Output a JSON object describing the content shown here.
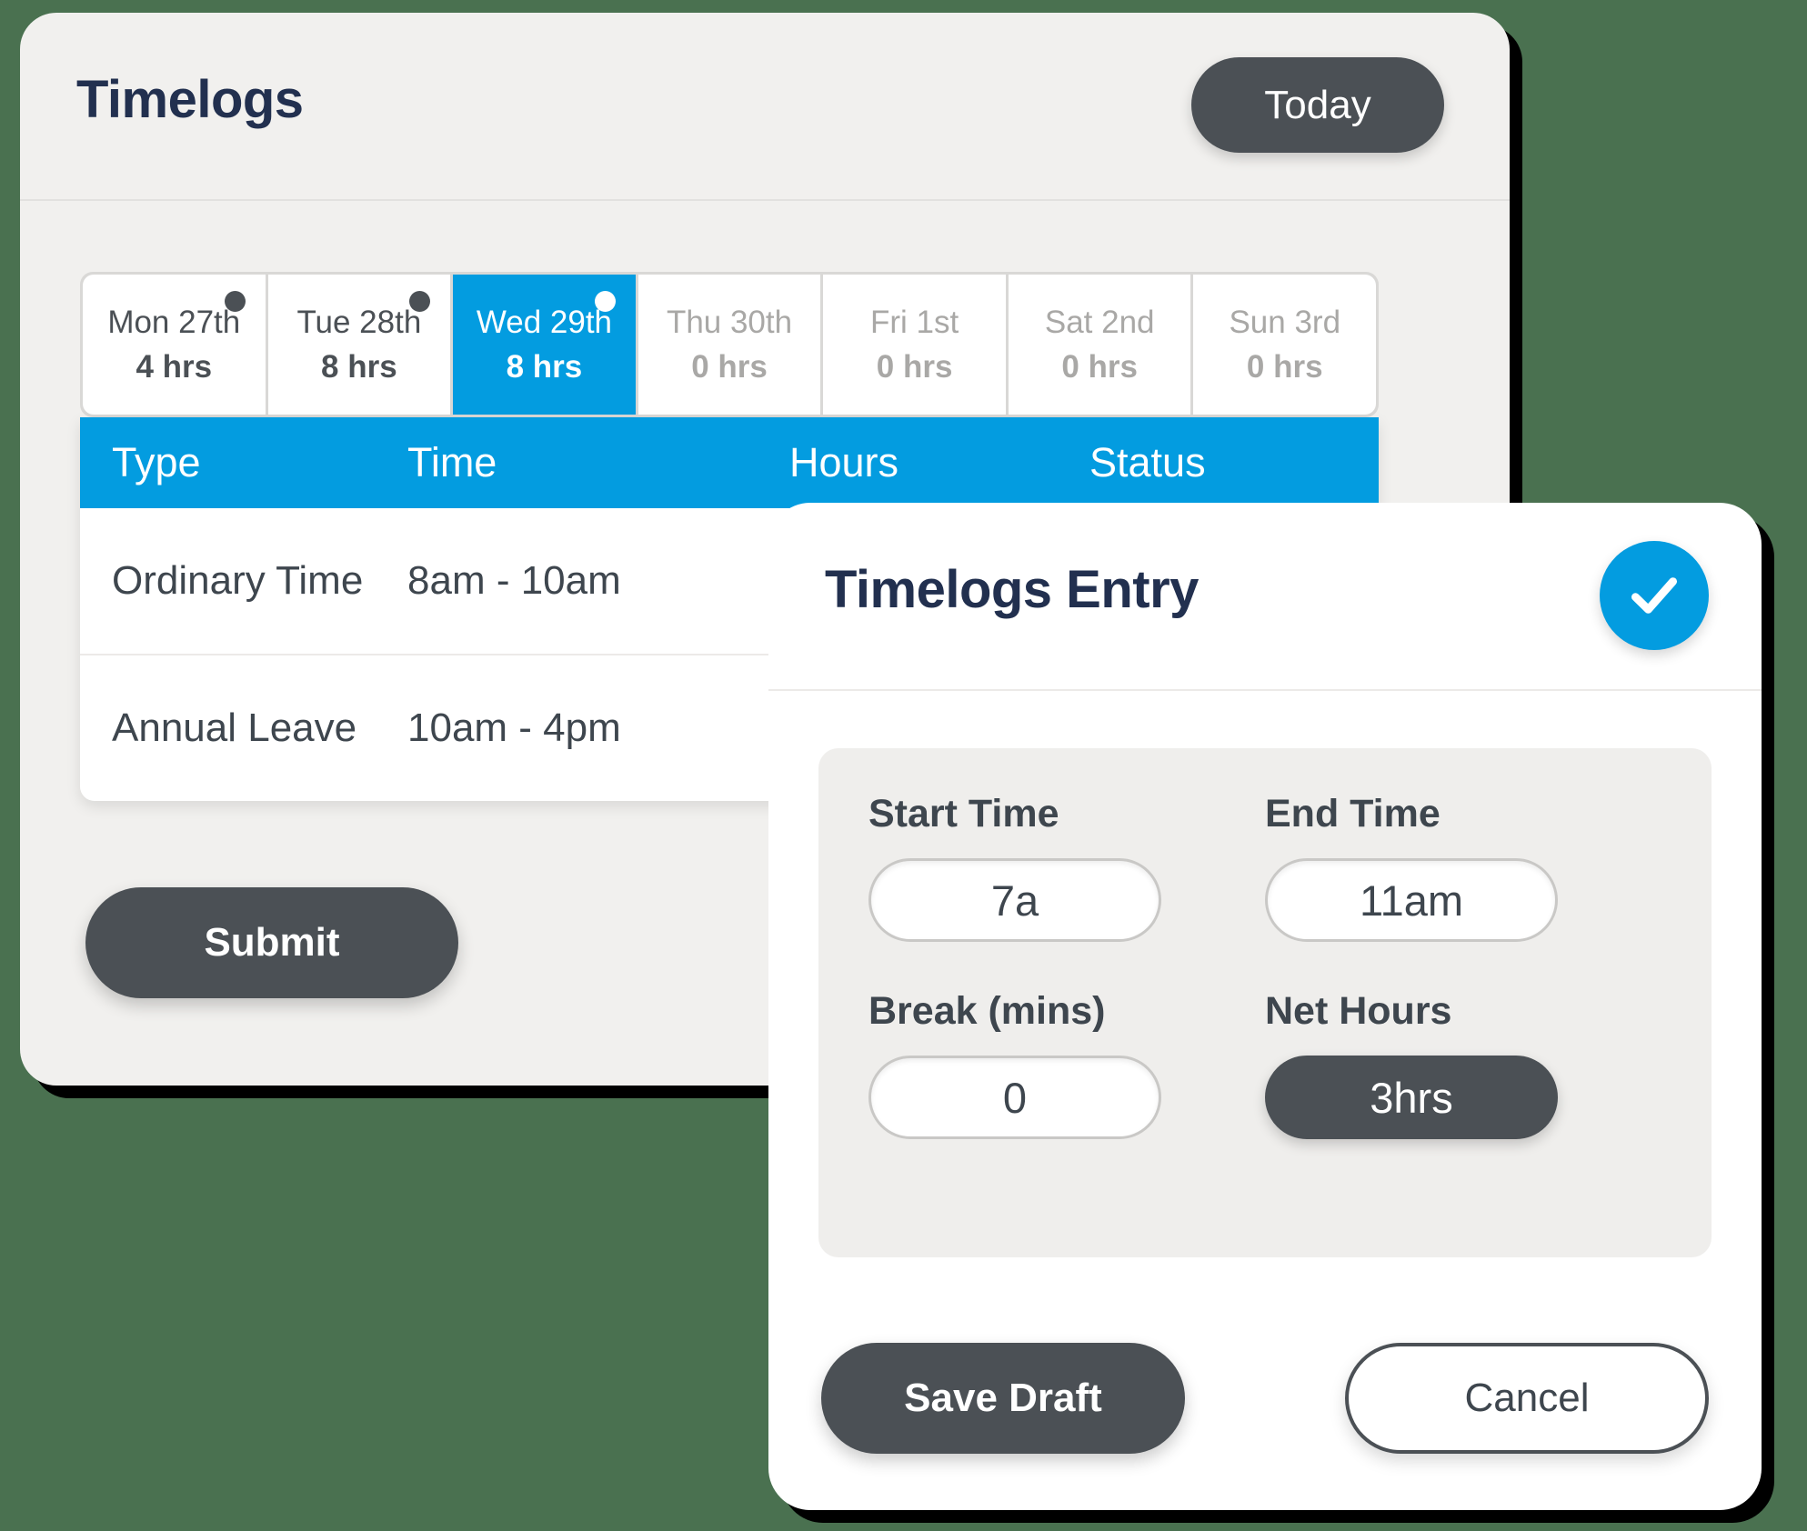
{
  "colors": {
    "page_background": "#4a7150",
    "accent_blue": "#039ce0",
    "dark_slate": "#4b5055",
    "navy_title": "#22304f",
    "card_background": "#f1f0ee"
  },
  "timelogs_card": {
    "title": "Timelogs",
    "today_button": "Today",
    "submit_button": "Submit",
    "days": [
      {
        "label": "Mon 27th",
        "hours": "4 hrs",
        "active": false,
        "has_dot": true
      },
      {
        "label": "Tue 28th",
        "hours": "8 hrs",
        "active": false,
        "has_dot": true
      },
      {
        "label": "Wed 29th",
        "hours": "8 hrs",
        "active": true,
        "has_dot": true
      },
      {
        "label": "Thu 30th",
        "hours": "0 hrs",
        "active": false,
        "has_dot": false
      },
      {
        "label": "Fri 1st",
        "hours": "0 hrs",
        "active": false,
        "has_dot": false
      },
      {
        "label": "Sat 2nd",
        "hours": "0 hrs",
        "active": false,
        "has_dot": false
      },
      {
        "label": "Sun 3rd",
        "hours": "0 hrs",
        "active": false,
        "has_dot": false
      }
    ],
    "table": {
      "columns": [
        "Type",
        "Time",
        "Hours",
        "Status"
      ],
      "rows": [
        {
          "type": "Ordinary Time",
          "time": "8am - 10am",
          "hours": "",
          "status": ""
        },
        {
          "type": "Annual Leave",
          "time": "10am - 4pm",
          "hours": "",
          "status": ""
        }
      ]
    }
  },
  "entry_modal": {
    "title": "Timelogs Entry",
    "confirm_icon": "check-circle-icon",
    "fields": {
      "start_time": {
        "label": "Start Time",
        "value": "7a"
      },
      "end_time": {
        "label": "End Time",
        "value": "11am"
      },
      "break_mins": {
        "label": "Break (mins)",
        "value": "0"
      },
      "net_hours": {
        "label": "Net Hours",
        "value": "3hrs"
      }
    },
    "actions": {
      "save_draft": "Save Draft",
      "cancel": "Cancel"
    }
  }
}
